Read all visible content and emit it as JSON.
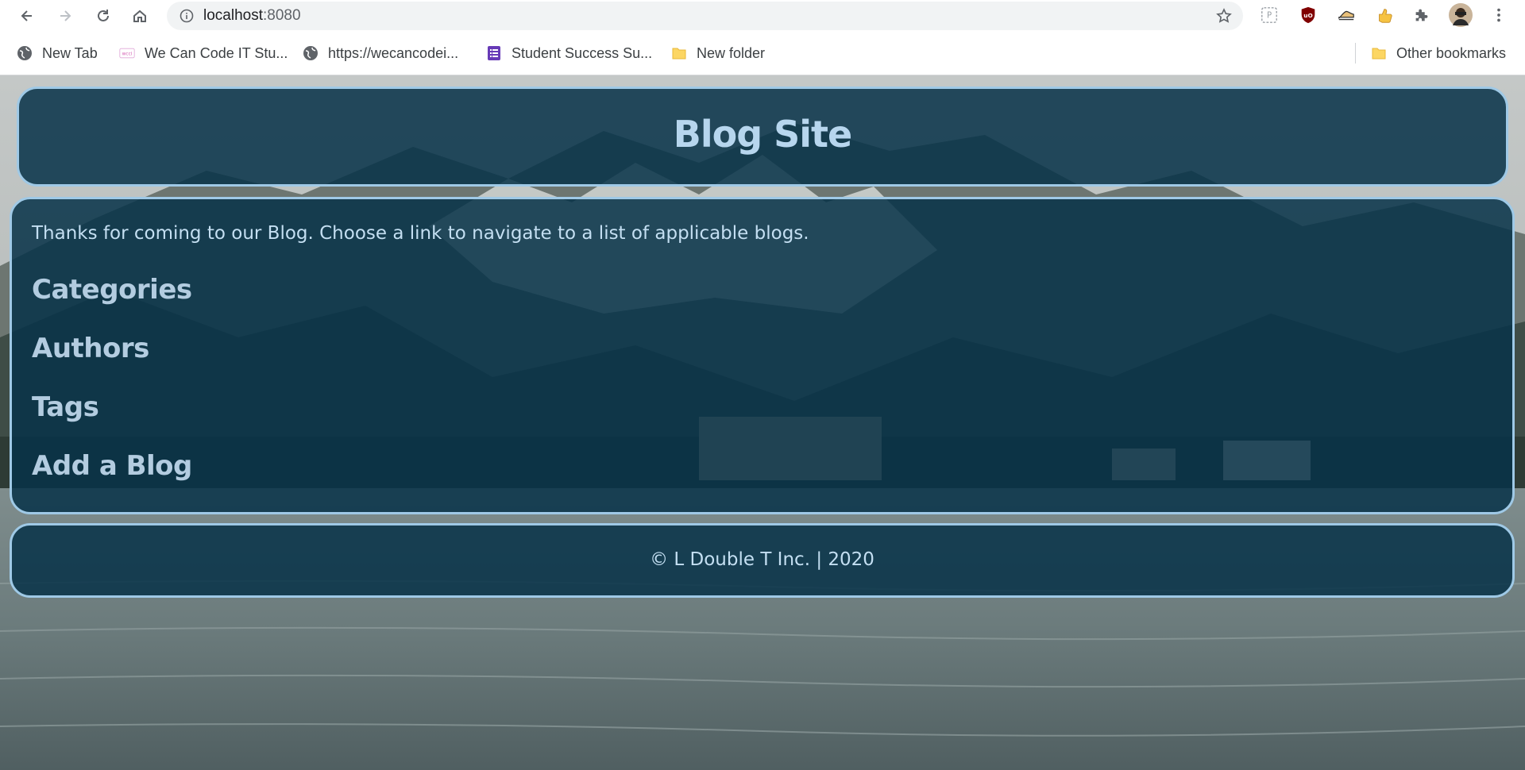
{
  "browser": {
    "url_host": "localhost",
    "url_port": ":8080",
    "bookmarks": [
      {
        "label": "New Tab",
        "icon": "globe-icon"
      },
      {
        "label": "We Can Code IT Stu...",
        "icon": "wcci-logo-icon"
      },
      {
        "label": "https://wecancodei...",
        "icon": "globe-icon"
      },
      {
        "label": "Student Success Su...",
        "icon": "google-forms-icon"
      },
      {
        "label": "New folder",
        "icon": "folder-icon"
      }
    ],
    "other_bookmarks": "Other bookmarks",
    "extensions": [
      "shield-ext-icon",
      "ublock-icon",
      "sneaker-ext-icon",
      "thumbs-up-icon",
      "puzzle-icon",
      "profile-avatar",
      "kebab-menu-icon"
    ]
  },
  "site": {
    "title": "Blog Site",
    "intro": "Thanks for coming to our Blog. Choose a link to navigate to a list of applicable blogs.",
    "links": [
      "Categories",
      "Authors",
      "Tags",
      "Add a Blog"
    ],
    "footer": "© L Double T Inc. | 2020"
  },
  "colors": {
    "panel_bg": "#073248",
    "panel_border": "#9fc9e6",
    "title_text": "#b7d6ee",
    "link_text": "#b3cce0"
  }
}
